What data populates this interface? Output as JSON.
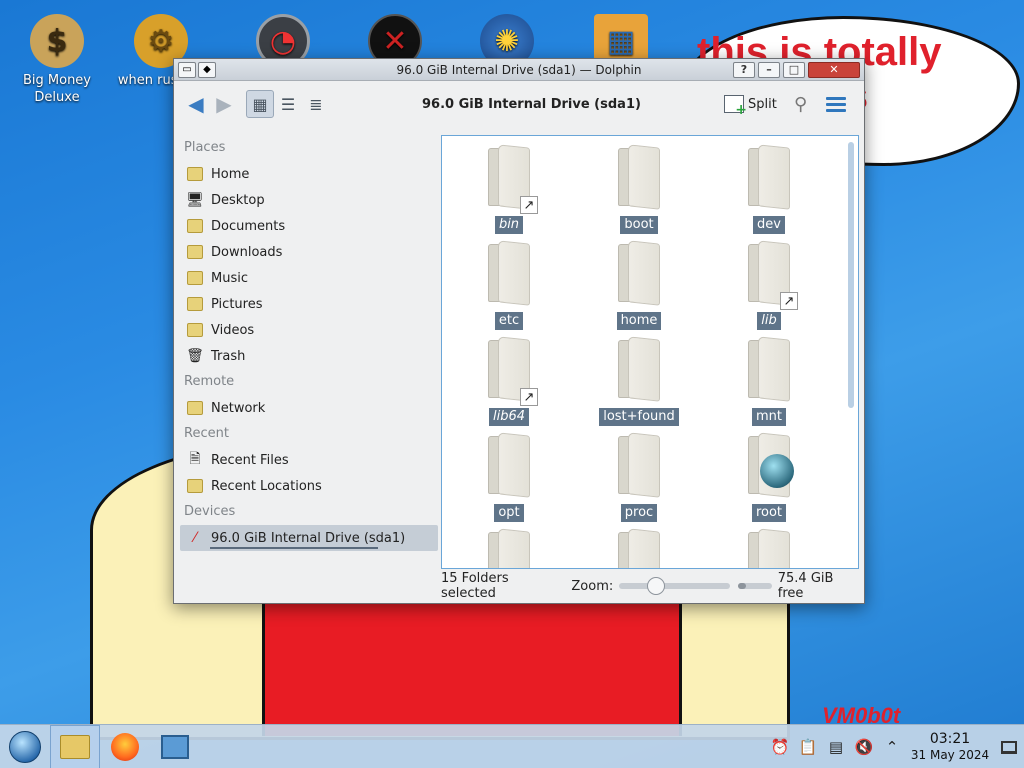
{
  "wallpaper": {
    "bubble_text": "this is totally\n    7 guys",
    "signature": "VM0b0t",
    "accent_red": "#e0212c"
  },
  "desktop_icons": [
    {
      "label": "Big Money Deluxe",
      "icon": "money-bag-icon"
    },
    {
      "label": "when russian",
      "icon": "gear-icon"
    },
    {
      "label": "",
      "icon": "speedometer-icon"
    },
    {
      "label": "",
      "icon": "red-dark-icon"
    },
    {
      "label": "",
      "icon": "globe-icon"
    },
    {
      "label": "",
      "icon": "office-icon"
    }
  ],
  "window": {
    "title": "96.0 GiB Internal Drive (sda1) — Dolphin",
    "location": "96.0 GiB Internal Drive (sda1)",
    "split_label": "Split"
  },
  "places": {
    "sections": {
      "places": "Places",
      "remote": "Remote",
      "recent": "Recent",
      "devices": "Devices"
    },
    "items": [
      "Home",
      "Desktop",
      "Documents",
      "Downloads",
      "Music",
      "Pictures",
      "Videos",
      "Trash"
    ],
    "remote_items": [
      "Network"
    ],
    "recent_items": [
      "Recent Files",
      "Recent Locations"
    ],
    "device_items": [
      "96.0 GiB Internal Drive (sda1)"
    ]
  },
  "files": [
    {
      "name": "bin",
      "link": true
    },
    {
      "name": "boot",
      "link": false
    },
    {
      "name": "dev",
      "link": false
    },
    {
      "name": "etc",
      "link": false
    },
    {
      "name": "home",
      "link": false
    },
    {
      "name": "lib",
      "link": true
    },
    {
      "name": "lib64",
      "link": true
    },
    {
      "name": "lost+found",
      "link": false
    },
    {
      "name": "mnt",
      "link": false
    },
    {
      "name": "opt",
      "link": false
    },
    {
      "name": "proc",
      "link": false
    },
    {
      "name": "root",
      "link": false
    }
  ],
  "status": {
    "selection": "15 Folders selected",
    "zoom_label": "Zoom:",
    "free_space": "75.4 GiB free"
  },
  "taskbar": {
    "time": "03:21",
    "date": "31 May 2024"
  }
}
